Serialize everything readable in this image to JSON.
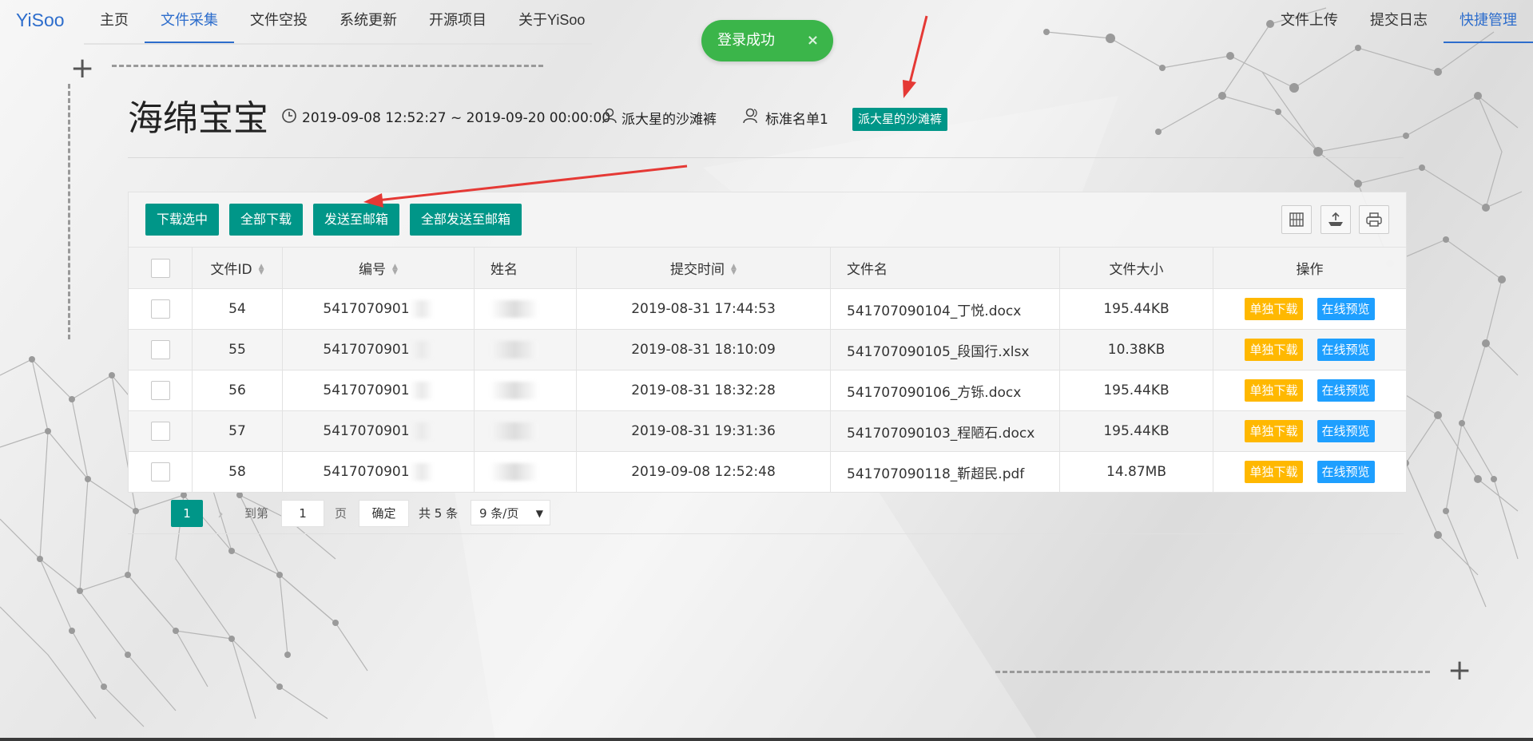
{
  "nav": {
    "logo": "YiSoo",
    "left": [
      "主页",
      "文件采集",
      "文件空投",
      "系统更新",
      "开源项目",
      "关于YiSoo"
    ],
    "right": [
      "文件上传",
      "提交日志",
      "快捷管理"
    ]
  },
  "toast": {
    "message": "登录成功",
    "close": "×"
  },
  "header": {
    "title": "海绵宝宝",
    "time_range": "2019-09-08 12:52:27 ~ 2019-09-20 00:00:00",
    "owner": "派大星的沙滩裤",
    "list_name": "标准名单1",
    "tag": "派大星的沙滩裤"
  },
  "toolbar": {
    "download_selected": "下载选中",
    "download_all": "全部下载",
    "send_email": "发送至邮箱",
    "send_all_email": "全部发送至邮箱",
    "icons": [
      "columns-icon",
      "export-icon",
      "print-icon"
    ]
  },
  "table": {
    "columns": [
      "文件ID",
      "编号",
      "姓名",
      "提交时间",
      "文件名",
      "文件大小",
      "操作"
    ],
    "rows": [
      {
        "id": "54",
        "code": "5417070901",
        "time": "2019-08-31 17:44:53",
        "file": "541707090104_丁悦.docx",
        "size": "195.44KB"
      },
      {
        "id": "55",
        "code": "5417070901",
        "time": "2019-08-31 18:10:09",
        "file": "541707090105_段国行.xlsx",
        "size": "10.38KB"
      },
      {
        "id": "56",
        "code": "5417070901",
        "time": "2019-08-31 18:32:28",
        "file": "541707090106_方铄.docx",
        "size": "195.44KB"
      },
      {
        "id": "57",
        "code": "5417070901",
        "time": "2019-08-31 19:31:36",
        "file": "541707090103_程陋石.docx",
        "size": "195.44KB"
      },
      {
        "id": "58",
        "code": "5417070901",
        "time": "2019-09-08 12:52:48",
        "file": "541707090118_靳超民.pdf",
        "size": "14.87MB"
      }
    ],
    "action_download": "单独下载",
    "action_preview": "在线预览"
  },
  "pagination": {
    "current": "1",
    "goto": "到第",
    "page_input": "1",
    "page_unit": "页",
    "confirm": "确定",
    "total": "共 5 条",
    "per_page": "9 条/页"
  },
  "colors": {
    "primary": "#009688",
    "toast": "#3bb54a",
    "warn": "#ffb800",
    "info": "#1e9fff",
    "nav_active": "#2d6dcc",
    "arrow": "#e53935"
  }
}
